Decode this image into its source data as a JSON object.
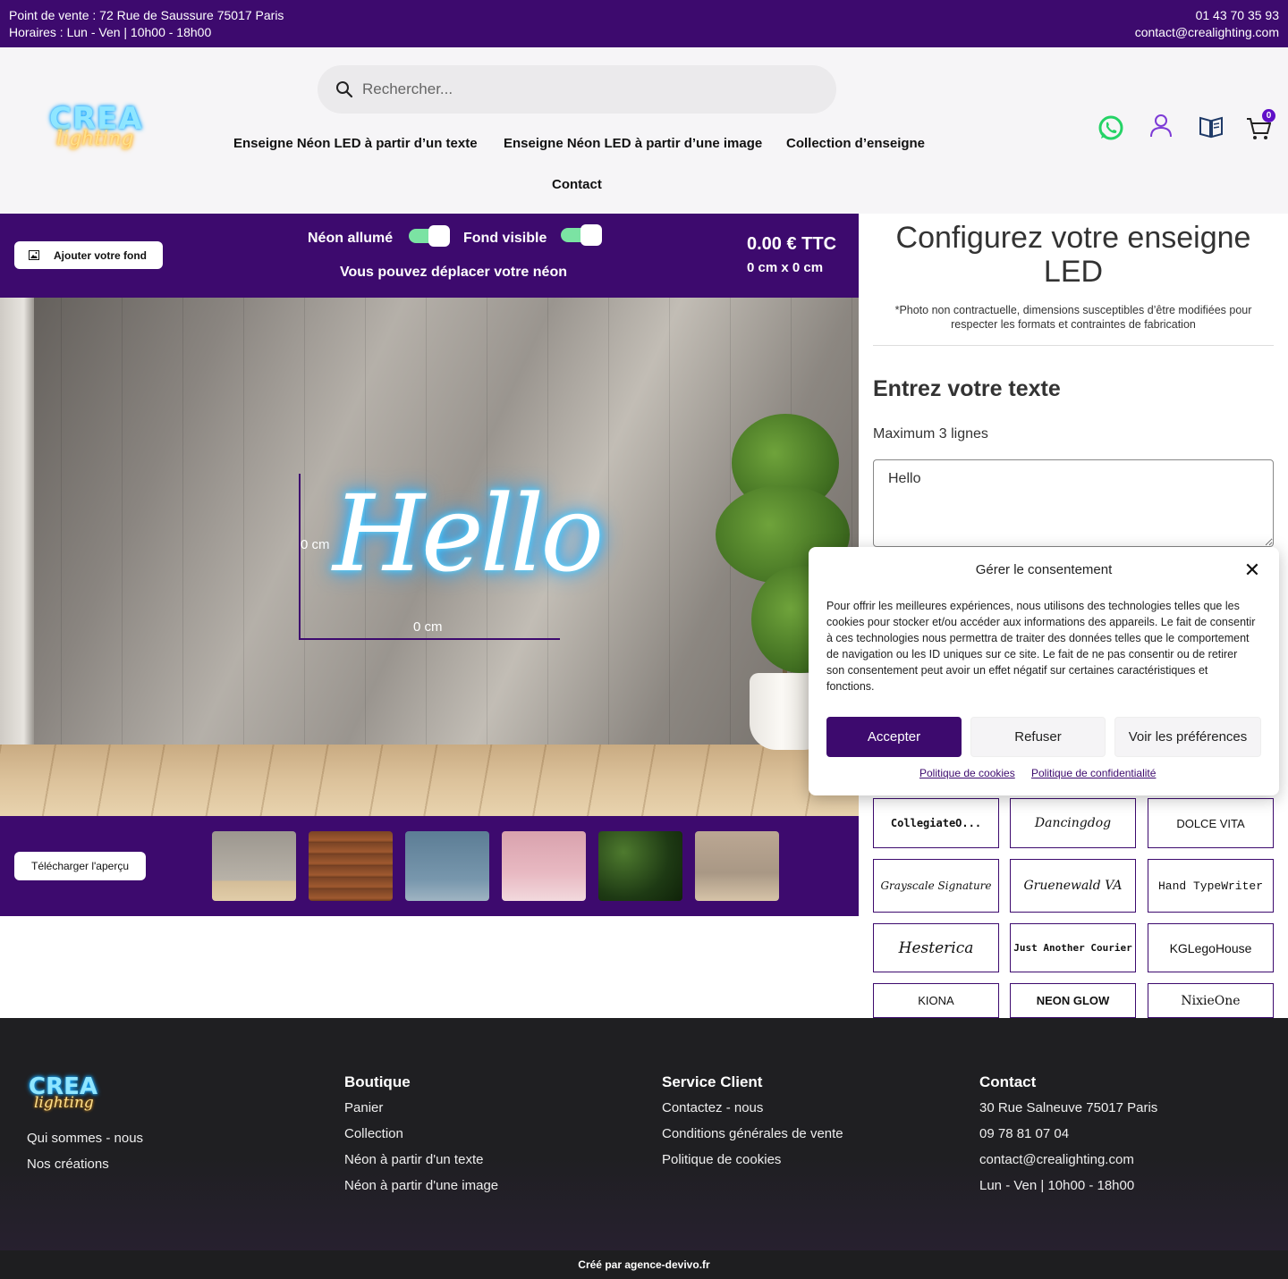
{
  "topbar": {
    "address": "Point de vente : 72 Rue de Saussure 75017 Paris",
    "hours": "Horaires : Lun - Ven | 10h00 - 18h00",
    "phone": "01 43 70 35 93",
    "email": "contact@crealighting.com"
  },
  "header": {
    "logo_crea": "CREA",
    "logo_lighting": "lighting",
    "search_placeholder": "Rechercher...",
    "nav": [
      "Enseigne Néon LED à partir d’un texte",
      "Enseigne Néon LED à partir d’une image",
      "Collection d’enseigne",
      "Contact"
    ],
    "cart_count": "0"
  },
  "configurator": {
    "add_bg_label": "Ajouter votre fond",
    "neon_on_label": "Néon allumé",
    "bg_visible_label": "Fond visible",
    "move_hint": "Vous pouvez déplacer votre néon",
    "price": "0.00 € TTC",
    "dimensions": "0 cm x 0 cm",
    "neon_text": "Hello",
    "height_label": "0 cm",
    "width_label": "0 cm",
    "download_label": "Télécharger l'aperçu",
    "neon_on": true,
    "bg_visible": true
  },
  "panel": {
    "title": "Configurez votre enseigne LED",
    "note": "*Photo non contractuelle, dimensions susceptibles d’être modifiées pour respecter les formats et contraintes de fabrication",
    "section_title": "Entrez votre texte",
    "max_lines": "Maximum 3 lignes",
    "text_value": "Hello",
    "fonts": [
      "CollegiateO...",
      "Dancingdog",
      "DOLCE VITA",
      "Grayscale Signature",
      "Gruenewald VA",
      "Hand TypeWriter",
      "Hesterica",
      "Just Another Courier",
      "KGLegoHouse",
      "KIONA",
      "NEON GLOW",
      "NixieOne"
    ]
  },
  "consent": {
    "title": "Gérer le consentement",
    "body": "Pour offrir les meilleures expériences, nous utilisons des technologies telles que les cookies pour stocker et/ou accéder aux informations des appareils. Le fait de consentir à ces technologies nous permettra de traiter des données telles que le comportement de navigation ou les ID uniques sur ce site. Le fait de ne pas consentir ou de retirer son consentement peut avoir un effet négatif sur certaines caractéristiques et fonctions.",
    "accept": "Accepter",
    "refuse": "Refuser",
    "preferences": "Voir les préférences",
    "cookie_policy": "Politique de cookies",
    "privacy_policy": "Politique de confidentialité"
  },
  "footer": {
    "logo_crea": "CREA",
    "logo_lighting": "lighting",
    "about": [
      "Qui sommes - nous",
      "Nos créations"
    ],
    "boutique_title": "Boutique",
    "boutique": [
      "Panier",
      "Collection",
      "Néon à partir d'un texte",
      "Néon à partir d'une image"
    ],
    "service_title": "Service Client",
    "service": [
      "Contactez - nous",
      "Conditions générales de vente",
      "Politique de cookies"
    ],
    "contact_title": "Contact",
    "contact": [
      "30 Rue Salneuve 75017 Paris",
      "09 78 81 07 04",
      "contact@crealighting.com",
      "Lun - Ven | 10h00 - 18h00"
    ],
    "credit": "Créé par agence-devivo.fr"
  },
  "colors": {
    "brand": "#3d0a6e",
    "toggle": "#7be3a3",
    "whatsapp": "#25d366",
    "neon_glow": "#2bb8ff"
  }
}
